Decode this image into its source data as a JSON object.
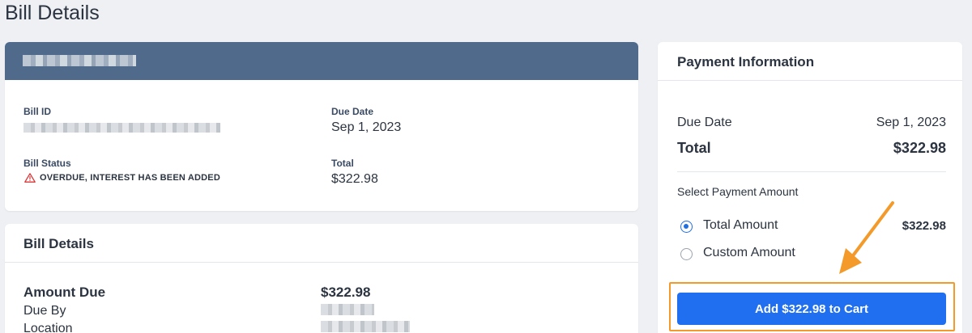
{
  "page": {
    "title": "Bill Details"
  },
  "bill_card": {
    "bill_id_label": "Bill ID",
    "due_date_label": "Due Date",
    "due_date_value": "Sep 1, 2023",
    "bill_status_label": "Bill Status",
    "bill_status_value": "OVERDUE, INTEREST HAS BEEN ADDED",
    "total_label": "Total",
    "total_value": "$322.98"
  },
  "details_card": {
    "title": "Bill Details",
    "amount_due_label": "Amount Due",
    "amount_due_value": "$322.98",
    "due_by_label": "Due By",
    "location_label": "Location"
  },
  "payment": {
    "title": "Payment Information",
    "due_date_label": "Due Date",
    "due_date_value": "Sep 1, 2023",
    "total_label": "Total",
    "total_value": "$322.98",
    "select_label": "Select Payment Amount",
    "options": [
      {
        "label": "Total Amount",
        "amount": "$322.98",
        "selected": true
      },
      {
        "label": "Custom Amount",
        "amount": "",
        "selected": false
      }
    ],
    "add_to_cart_label": "Add $322.98 to Cart"
  },
  "colors": {
    "header_band": "#4f6a8a",
    "primary_button": "#1f6ff0",
    "highlight": "#f39a2b",
    "warning": "#d93636"
  }
}
